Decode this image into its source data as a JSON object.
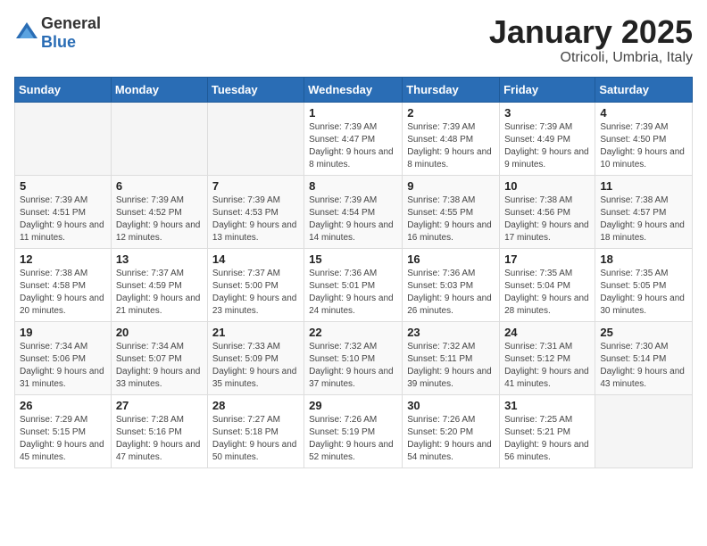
{
  "header": {
    "logo_general": "General",
    "logo_blue": "Blue",
    "month": "January 2025",
    "location": "Otricoli, Umbria, Italy"
  },
  "weekdays": [
    "Sunday",
    "Monday",
    "Tuesday",
    "Wednesday",
    "Thursday",
    "Friday",
    "Saturday"
  ],
  "weeks": [
    [
      {
        "day": "",
        "info": ""
      },
      {
        "day": "",
        "info": ""
      },
      {
        "day": "",
        "info": ""
      },
      {
        "day": "1",
        "info": "Sunrise: 7:39 AM\nSunset: 4:47 PM\nDaylight: 9 hours and 8 minutes."
      },
      {
        "day": "2",
        "info": "Sunrise: 7:39 AM\nSunset: 4:48 PM\nDaylight: 9 hours and 8 minutes."
      },
      {
        "day": "3",
        "info": "Sunrise: 7:39 AM\nSunset: 4:49 PM\nDaylight: 9 hours and 9 minutes."
      },
      {
        "day": "4",
        "info": "Sunrise: 7:39 AM\nSunset: 4:50 PM\nDaylight: 9 hours and 10 minutes."
      }
    ],
    [
      {
        "day": "5",
        "info": "Sunrise: 7:39 AM\nSunset: 4:51 PM\nDaylight: 9 hours and 11 minutes."
      },
      {
        "day": "6",
        "info": "Sunrise: 7:39 AM\nSunset: 4:52 PM\nDaylight: 9 hours and 12 minutes."
      },
      {
        "day": "7",
        "info": "Sunrise: 7:39 AM\nSunset: 4:53 PM\nDaylight: 9 hours and 13 minutes."
      },
      {
        "day": "8",
        "info": "Sunrise: 7:39 AM\nSunset: 4:54 PM\nDaylight: 9 hours and 14 minutes."
      },
      {
        "day": "9",
        "info": "Sunrise: 7:38 AM\nSunset: 4:55 PM\nDaylight: 9 hours and 16 minutes."
      },
      {
        "day": "10",
        "info": "Sunrise: 7:38 AM\nSunset: 4:56 PM\nDaylight: 9 hours and 17 minutes."
      },
      {
        "day": "11",
        "info": "Sunrise: 7:38 AM\nSunset: 4:57 PM\nDaylight: 9 hours and 18 minutes."
      }
    ],
    [
      {
        "day": "12",
        "info": "Sunrise: 7:38 AM\nSunset: 4:58 PM\nDaylight: 9 hours and 20 minutes."
      },
      {
        "day": "13",
        "info": "Sunrise: 7:37 AM\nSunset: 4:59 PM\nDaylight: 9 hours and 21 minutes."
      },
      {
        "day": "14",
        "info": "Sunrise: 7:37 AM\nSunset: 5:00 PM\nDaylight: 9 hours and 23 minutes."
      },
      {
        "day": "15",
        "info": "Sunrise: 7:36 AM\nSunset: 5:01 PM\nDaylight: 9 hours and 24 minutes."
      },
      {
        "day": "16",
        "info": "Sunrise: 7:36 AM\nSunset: 5:03 PM\nDaylight: 9 hours and 26 minutes."
      },
      {
        "day": "17",
        "info": "Sunrise: 7:35 AM\nSunset: 5:04 PM\nDaylight: 9 hours and 28 minutes."
      },
      {
        "day": "18",
        "info": "Sunrise: 7:35 AM\nSunset: 5:05 PM\nDaylight: 9 hours and 30 minutes."
      }
    ],
    [
      {
        "day": "19",
        "info": "Sunrise: 7:34 AM\nSunset: 5:06 PM\nDaylight: 9 hours and 31 minutes."
      },
      {
        "day": "20",
        "info": "Sunrise: 7:34 AM\nSunset: 5:07 PM\nDaylight: 9 hours and 33 minutes."
      },
      {
        "day": "21",
        "info": "Sunrise: 7:33 AM\nSunset: 5:09 PM\nDaylight: 9 hours and 35 minutes."
      },
      {
        "day": "22",
        "info": "Sunrise: 7:32 AM\nSunset: 5:10 PM\nDaylight: 9 hours and 37 minutes."
      },
      {
        "day": "23",
        "info": "Sunrise: 7:32 AM\nSunset: 5:11 PM\nDaylight: 9 hours and 39 minutes."
      },
      {
        "day": "24",
        "info": "Sunrise: 7:31 AM\nSunset: 5:12 PM\nDaylight: 9 hours and 41 minutes."
      },
      {
        "day": "25",
        "info": "Sunrise: 7:30 AM\nSunset: 5:14 PM\nDaylight: 9 hours and 43 minutes."
      }
    ],
    [
      {
        "day": "26",
        "info": "Sunrise: 7:29 AM\nSunset: 5:15 PM\nDaylight: 9 hours and 45 minutes."
      },
      {
        "day": "27",
        "info": "Sunrise: 7:28 AM\nSunset: 5:16 PM\nDaylight: 9 hours and 47 minutes."
      },
      {
        "day": "28",
        "info": "Sunrise: 7:27 AM\nSunset: 5:18 PM\nDaylight: 9 hours and 50 minutes."
      },
      {
        "day": "29",
        "info": "Sunrise: 7:26 AM\nSunset: 5:19 PM\nDaylight: 9 hours and 52 minutes."
      },
      {
        "day": "30",
        "info": "Sunrise: 7:26 AM\nSunset: 5:20 PM\nDaylight: 9 hours and 54 minutes."
      },
      {
        "day": "31",
        "info": "Sunrise: 7:25 AM\nSunset: 5:21 PM\nDaylight: 9 hours and 56 minutes."
      },
      {
        "day": "",
        "info": ""
      }
    ]
  ]
}
